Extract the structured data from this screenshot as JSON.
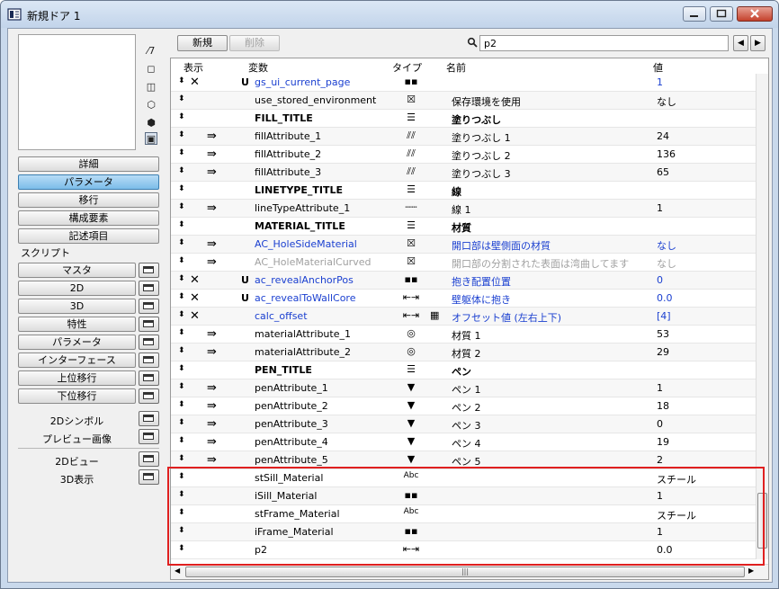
{
  "window": {
    "title": "新規ドア 1"
  },
  "left_panel": {
    "tabs": [
      {
        "label": "詳細",
        "selected": false
      },
      {
        "label": "パラメータ",
        "selected": true
      },
      {
        "label": "移行",
        "selected": false
      },
      {
        "label": "構成要素",
        "selected": false
      },
      {
        "label": "記述項目",
        "selected": false
      }
    ],
    "scripts_heading": "スクリプト",
    "scripts": [
      "マスタ",
      "2D",
      "3D",
      "特性",
      "パラメータ",
      "インターフェース",
      "上位移行",
      "下位移行"
    ],
    "symbol_items": [
      "2Dシンボル",
      "プレビュー画像"
    ],
    "view_items": [
      "2Dビュー",
      "3D表示"
    ]
  },
  "toolbar": {
    "new_label": "新規",
    "delete_label": "削除",
    "search_value": "p2"
  },
  "table": {
    "headers": {
      "show": "表示",
      "variable": "変数",
      "type": "タイプ",
      "name": "名前",
      "value": "値"
    },
    "rows": [
      {
        "hide": "✕",
        "arrow": "",
        "flag": "U",
        "variable": "gs_ui_current_page",
        "type_icon": "integer-icon",
        "array": "",
        "name": "",
        "value": "1",
        "style": "blue"
      },
      {
        "hide": "",
        "arrow": "",
        "flag": "",
        "variable": "use_stored_environment",
        "type_icon": "boolean-icon",
        "array": "",
        "name": "保存環境を使用",
        "value": "なし",
        "style": ""
      },
      {
        "hide": "",
        "arrow": "",
        "flag": "",
        "variable": "FILL_TITLE",
        "type_icon": "title-icon",
        "array": "",
        "name": "塗りつぶし",
        "value": "",
        "style": "bold"
      },
      {
        "hide": "",
        "arrow": "⇛",
        "flag": "",
        "variable": "fillAttribute_1",
        "type_icon": "fill-icon",
        "array": "",
        "name": "塗りつぶし 1",
        "value": "24",
        "style": ""
      },
      {
        "hide": "",
        "arrow": "⇛",
        "flag": "",
        "variable": "fillAttribute_2",
        "type_icon": "fill-icon",
        "array": "",
        "name": "塗りつぶし 2",
        "value": "136",
        "style": ""
      },
      {
        "hide": "",
        "arrow": "⇛",
        "flag": "",
        "variable": "fillAttribute_3",
        "type_icon": "fill-icon",
        "array": "",
        "name": "塗りつぶし 3",
        "value": "65",
        "style": ""
      },
      {
        "hide": "",
        "arrow": "",
        "flag": "",
        "variable": "LINETYPE_TITLE",
        "type_icon": "title-icon",
        "array": "",
        "name": "線",
        "value": "",
        "style": "bold"
      },
      {
        "hide": "",
        "arrow": "⇛",
        "flag": "",
        "variable": "lineTypeAttribute_1",
        "type_icon": "linetype-icon",
        "array": "",
        "name": "線 1",
        "value": "1",
        "style": ""
      },
      {
        "hide": "",
        "arrow": "",
        "flag": "",
        "variable": "MATERIAL_TITLE",
        "type_icon": "title-icon",
        "array": "",
        "name": "材質",
        "value": "",
        "style": "bold"
      },
      {
        "hide": "",
        "arrow": "⇛",
        "flag": "",
        "variable": "AC_HoleSideMaterial",
        "type_icon": "boolean-icon",
        "array": "",
        "name": "開口部は壁側面の材質",
        "value": "なし",
        "style": "blue"
      },
      {
        "hide": "",
        "arrow": "⇛",
        "flag": "",
        "variable": "AC_HoleMaterialCurved",
        "type_icon": "boolean-icon",
        "array": "",
        "name": "開口部の分割された表面は湾曲してます",
        "value": "なし",
        "style": "gray"
      },
      {
        "hide": "✕",
        "arrow": "",
        "flag": "U",
        "variable": "ac_revealAnchorPos",
        "type_icon": "integer-icon",
        "array": "",
        "name": "抱き配置位置",
        "value": "0",
        "style": "blue"
      },
      {
        "hide": "✕",
        "arrow": "",
        "flag": "U",
        "variable": "ac_revealToWallCore",
        "type_icon": "length-icon",
        "array": "",
        "name": "壁躯体に抱き",
        "value": "0.0",
        "style": "blue"
      },
      {
        "hide": "✕",
        "arrow": "",
        "flag": "",
        "variable": "calc_offset",
        "type_icon": "length-icon",
        "array": "array-icon",
        "name": "オフセット値 (左右上下)",
        "value": "[4]",
        "style": "blue"
      },
      {
        "hide": "",
        "arrow": "⇛",
        "flag": "",
        "variable": "materialAttribute_1",
        "type_icon": "material-icon",
        "array": "",
        "name": "材質 1",
        "value": "53",
        "style": ""
      },
      {
        "hide": "",
        "arrow": "⇛",
        "flag": "",
        "variable": "materialAttribute_2",
        "type_icon": "material-icon",
        "array": "",
        "name": "材質 2",
        "value": "29",
        "style": ""
      },
      {
        "hide": "",
        "arrow": "",
        "flag": "",
        "variable": "PEN_TITLE",
        "type_icon": "title-icon",
        "array": "",
        "name": "ペン",
        "value": "",
        "style": "bold"
      },
      {
        "hide": "",
        "arrow": "⇛",
        "flag": "",
        "variable": "penAttribute_1",
        "type_icon": "pen-icon",
        "array": "",
        "name": "ペン 1",
        "value": "1",
        "style": ""
      },
      {
        "hide": "",
        "arrow": "⇛",
        "flag": "",
        "variable": "penAttribute_2",
        "type_icon": "pen-icon",
        "array": "",
        "name": "ペン 2",
        "value": "18",
        "style": ""
      },
      {
        "hide": "",
        "arrow": "⇛",
        "flag": "",
        "variable": "penAttribute_3",
        "type_icon": "pen-icon",
        "array": "",
        "name": "ペン 3",
        "value": "0",
        "style": ""
      },
      {
        "hide": "",
        "arrow": "⇛",
        "flag": "",
        "variable": "penAttribute_4",
        "type_icon": "pen-icon",
        "array": "",
        "name": "ペン 4",
        "value": "19",
        "style": ""
      },
      {
        "hide": "",
        "arrow": "⇛",
        "flag": "",
        "variable": "penAttribute_5",
        "type_icon": "pen-icon",
        "array": "",
        "name": "ペン 5",
        "value": "2",
        "style": ""
      },
      {
        "hide": "",
        "arrow": "",
        "flag": "",
        "variable": "stSill_Material",
        "type_icon": "string-icon",
        "array": "",
        "name": "",
        "value": "スチール",
        "style": ""
      },
      {
        "hide": "",
        "arrow": "",
        "flag": "",
        "variable": "iSill_Material",
        "type_icon": "integer-icon",
        "array": "",
        "name": "",
        "value": "1",
        "style": ""
      },
      {
        "hide": "",
        "arrow": "",
        "flag": "",
        "variable": "stFrame_Material",
        "type_icon": "string-icon",
        "array": "",
        "name": "",
        "value": "スチール",
        "style": ""
      },
      {
        "hide": "",
        "arrow": "",
        "flag": "",
        "variable": "iFrame_Material",
        "type_icon": "integer-icon",
        "array": "",
        "name": "",
        "value": "1",
        "style": ""
      },
      {
        "hide": "",
        "arrow": "",
        "flag": "",
        "variable": "p2",
        "type_icon": "length-icon",
        "array": "",
        "name": "",
        "value": "0.0",
        "style": ""
      }
    ]
  },
  "type_icon_glyphs": {
    "string-icon": "Abc",
    "boolean-icon": "☒",
    "fill-icon": "⫽⫽",
    "title-icon": "☰",
    "linetype-icon": "┄┄",
    "material-icon": "◎",
    "pen-icon": "▼",
    "integer-icon": "▪▪",
    "length-icon": "⇤⇥",
    "array-icon": "▦"
  },
  "colors": {
    "highlight": "#e02020",
    "blue_text": "#1a3fd0",
    "gray_text": "#a0a0a0",
    "selected_tab": "#7cbde9"
  }
}
